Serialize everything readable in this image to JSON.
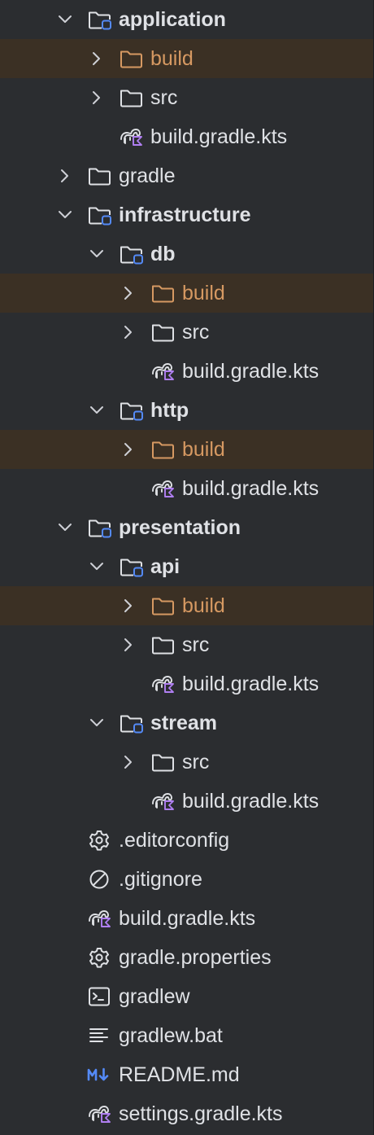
{
  "tree": {
    "items": [
      {
        "name": "folder-application",
        "label": "application",
        "depth": 1,
        "chevron": "down",
        "icon": "module",
        "bold": true
      },
      {
        "name": "folder-application-build",
        "label": "build",
        "depth": 2,
        "chevron": "right",
        "icon": "folder-excluded",
        "excluded": true
      },
      {
        "name": "folder-application-src",
        "label": "src",
        "depth": 2,
        "chevron": "right",
        "icon": "folder"
      },
      {
        "name": "file-application-build-gradle-kts",
        "label": "build.gradle.kts",
        "depth": 2,
        "icon": "gradle-kts"
      },
      {
        "name": "folder-gradle",
        "label": "gradle",
        "depth": 1,
        "chevron": "right",
        "icon": "folder"
      },
      {
        "name": "folder-infrastructure",
        "label": "infrastructure",
        "depth": 1,
        "chevron": "down",
        "icon": "module",
        "bold": true
      },
      {
        "name": "folder-db",
        "label": "db",
        "depth": 2,
        "chevron": "down",
        "icon": "module",
        "bold": true
      },
      {
        "name": "folder-db-build",
        "label": "build",
        "depth": 3,
        "chevron": "right",
        "icon": "folder-excluded",
        "excluded": true
      },
      {
        "name": "folder-db-src",
        "label": "src",
        "depth": 3,
        "chevron": "right",
        "icon": "folder"
      },
      {
        "name": "file-db-build-gradle-kts",
        "label": "build.gradle.kts",
        "depth": 3,
        "icon": "gradle-kts"
      },
      {
        "name": "folder-http",
        "label": "http",
        "depth": 2,
        "chevron": "down",
        "icon": "module",
        "bold": true
      },
      {
        "name": "folder-http-build",
        "label": "build",
        "depth": 3,
        "chevron": "right",
        "icon": "folder-excluded",
        "excluded": true
      },
      {
        "name": "file-http-build-gradle-kts",
        "label": "build.gradle.kts",
        "depth": 3,
        "icon": "gradle-kts"
      },
      {
        "name": "folder-presentation",
        "label": "presentation",
        "depth": 1,
        "chevron": "down",
        "icon": "module",
        "bold": true
      },
      {
        "name": "folder-api",
        "label": "api",
        "depth": 2,
        "chevron": "down",
        "icon": "module",
        "bold": true
      },
      {
        "name": "folder-api-build",
        "label": "build",
        "depth": 3,
        "chevron": "right",
        "icon": "folder-excluded",
        "excluded": true
      },
      {
        "name": "folder-api-src",
        "label": "src",
        "depth": 3,
        "chevron": "right",
        "icon": "folder"
      },
      {
        "name": "file-api-build-gradle-kts",
        "label": "build.gradle.kts",
        "depth": 3,
        "icon": "gradle-kts"
      },
      {
        "name": "folder-stream",
        "label": "stream",
        "depth": 2,
        "chevron": "down",
        "icon": "module",
        "bold": true
      },
      {
        "name": "folder-stream-src",
        "label": "src",
        "depth": 3,
        "chevron": "right",
        "icon": "folder"
      },
      {
        "name": "file-stream-build-gradle-kts",
        "label": "build.gradle.kts",
        "depth": 3,
        "icon": "gradle-kts"
      },
      {
        "name": "file-editorconfig",
        "label": ".editorconfig",
        "depth": 1,
        "icon": "gear"
      },
      {
        "name": "file-gitignore",
        "label": ".gitignore",
        "depth": 1,
        "icon": "ignore"
      },
      {
        "name": "file-root-build-gradle-kts",
        "label": "build.gradle.kts",
        "depth": 1,
        "icon": "gradle-kts"
      },
      {
        "name": "file-gradle-properties",
        "label": "gradle.properties",
        "depth": 1,
        "icon": "gear"
      },
      {
        "name": "file-gradlew",
        "label": "gradlew",
        "depth": 1,
        "icon": "terminal"
      },
      {
        "name": "file-gradlew-bat",
        "label": "gradlew.bat",
        "depth": 1,
        "icon": "text-lines"
      },
      {
        "name": "file-readme-md",
        "label": "README.md",
        "depth": 1,
        "icon": "markdown"
      },
      {
        "name": "file-settings-gradle-kts",
        "label": "settings.gradle.kts",
        "depth": 1,
        "icon": "gradle-kts"
      }
    ]
  },
  "colors": {
    "background": "#2b2d30",
    "text": "#dfe1e5",
    "excluded_text": "#d69962",
    "excluded_row": "#3b3024",
    "module_badge": "#548af7",
    "kotlin_badge": "#b07ff2",
    "chevron": "#ced0d6"
  }
}
